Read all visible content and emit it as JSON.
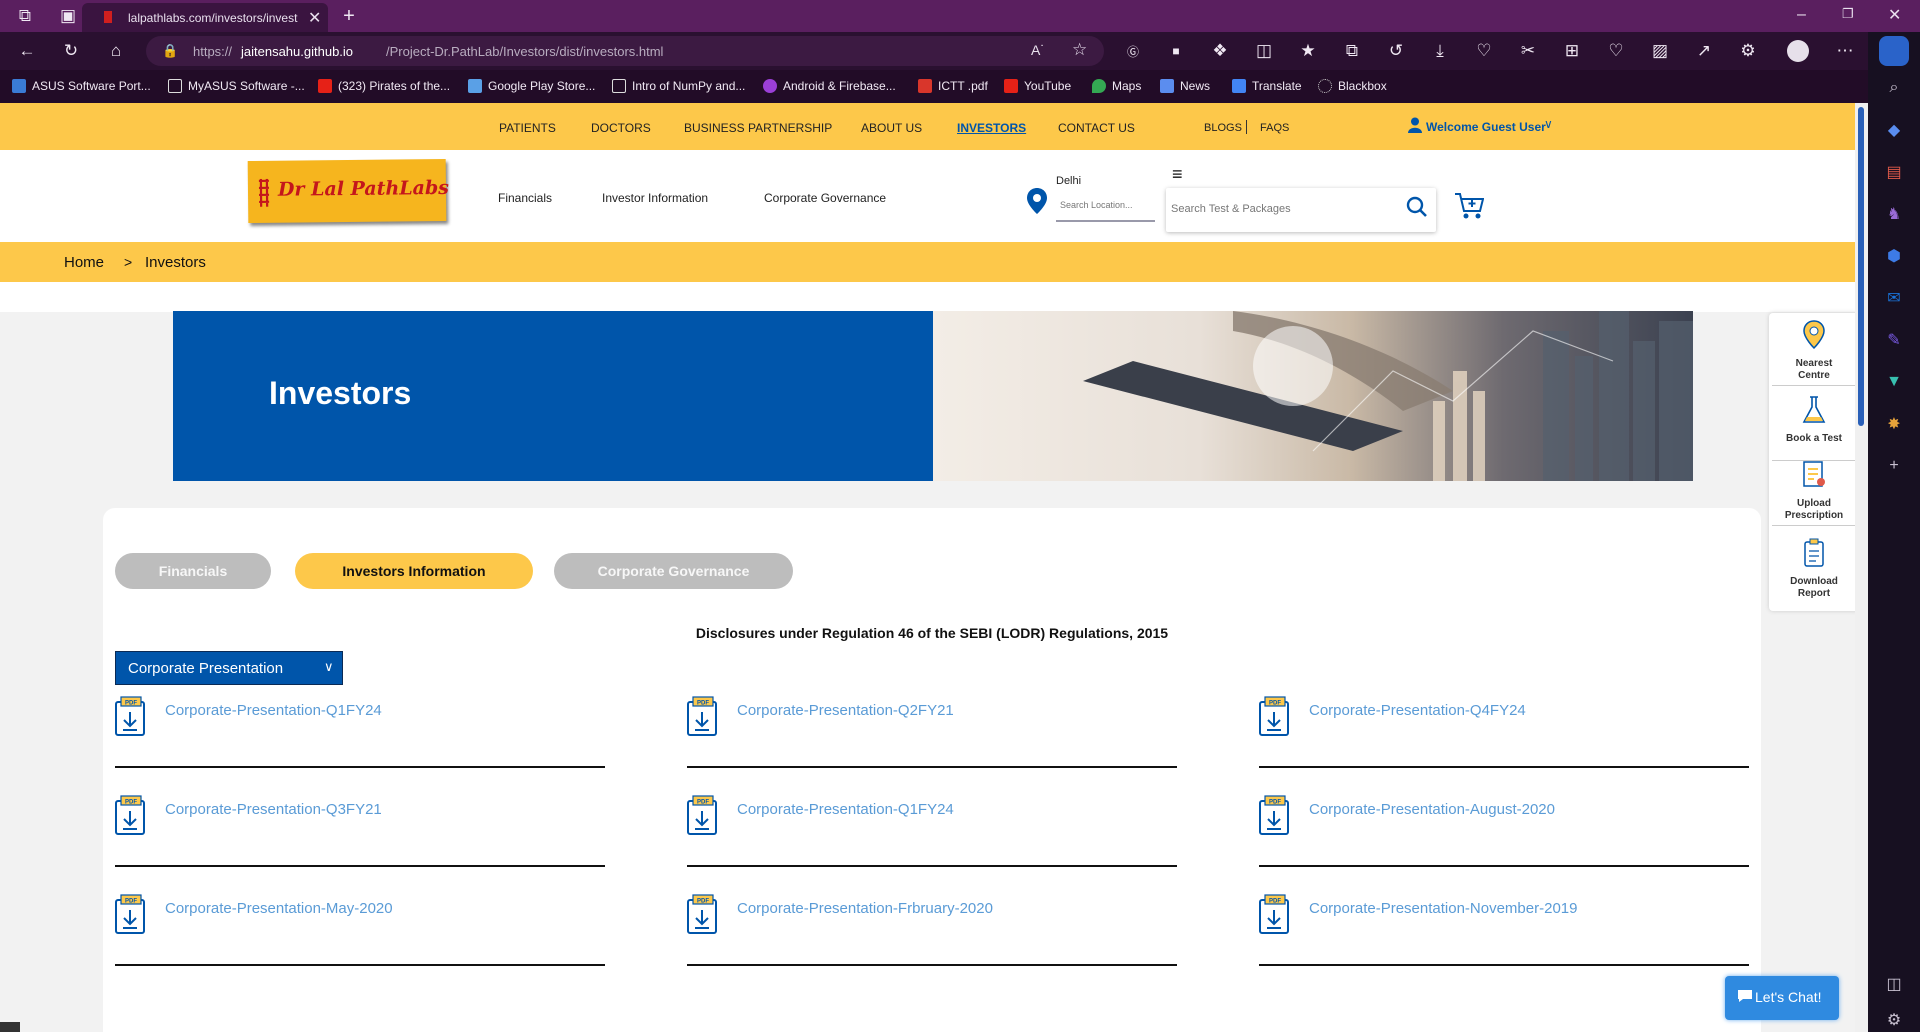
{
  "browser": {
    "tab_title": "lalpathlabs.com/investors/invest",
    "url_scheme": "https://",
    "url_host": "jaitensahu.github.io",
    "url_path": "/Project-Dr.PathLab/Investors/dist/investors.html",
    "favorites": [
      {
        "label": "ASUS Software Port..."
      },
      {
        "label": "MyASUS Software -..."
      },
      {
        "label": "(323) Pirates of the..."
      },
      {
        "label": "Google Play Store..."
      },
      {
        "label": "Intro of NumPy and..."
      },
      {
        "label": "Android & Firebase..."
      },
      {
        "label": "ICTT .pdf"
      },
      {
        "label": "YouTube"
      },
      {
        "label": "Maps"
      },
      {
        "label": "News"
      },
      {
        "label": "Translate"
      },
      {
        "label": "Blackbox"
      }
    ]
  },
  "topnav": {
    "items": [
      "PATIENTS",
      "DOCTORS",
      "BUSINESS PARTNERSHIP",
      "ABOUT US",
      "INVESTORS",
      "CONTACT US"
    ],
    "blogs": "BLOGS",
    "faqs": "FAQS",
    "welcome": "Welcome Guest User"
  },
  "header": {
    "logo_text": "Dr Lal PathLabs",
    "subnav": [
      "Financials",
      "Investor Information",
      "Corporate Governance"
    ],
    "city": "Delhi",
    "location_placeholder": "Search Location...",
    "search_placeholder": "Search Test & Packages"
  },
  "breadcrumb": {
    "home": "Home",
    "sep": ">",
    "current": "Investors"
  },
  "banner": {
    "title": "Investors"
  },
  "tabs": [
    {
      "label": "Financials",
      "active": false
    },
    {
      "label": "Investors Information",
      "active": true
    },
    {
      "label": "Corporate Governance",
      "active": false
    }
  ],
  "content": {
    "heading": "Disclosures under Regulation 46 of the SEBI (LODR) Regulations, 2015",
    "select_value": "Corporate Presentation",
    "documents": [
      "Corporate-Presentation-Q1FY24",
      "Corporate-Presentation-Q2FY21",
      "Corporate-Presentation-Q4FY24",
      "Corporate-Presentation-Q3FY21",
      "Corporate-Presentation-Q1FY24",
      "Corporate-Presentation-August-2020",
      "Corporate-Presentation-May-2020",
      "Corporate-Presentation-Frbruary-2020",
      "Corporate-Presentation-November-2019"
    ]
  },
  "float_menu": {
    "items": [
      {
        "label1": "Nearest",
        "label2": "Centre"
      },
      {
        "label1": "Book a Test",
        "label2": ""
      },
      {
        "label1": "Upload",
        "label2": "Prescription"
      },
      {
        "label1": "Download",
        "label2": "Report"
      }
    ]
  },
  "chat": {
    "label": "Let's Chat!"
  },
  "colors": {
    "accent_yellow": "#fdc84a",
    "brand_blue": "#0055aa",
    "link_blue": "#5a9bd6"
  }
}
